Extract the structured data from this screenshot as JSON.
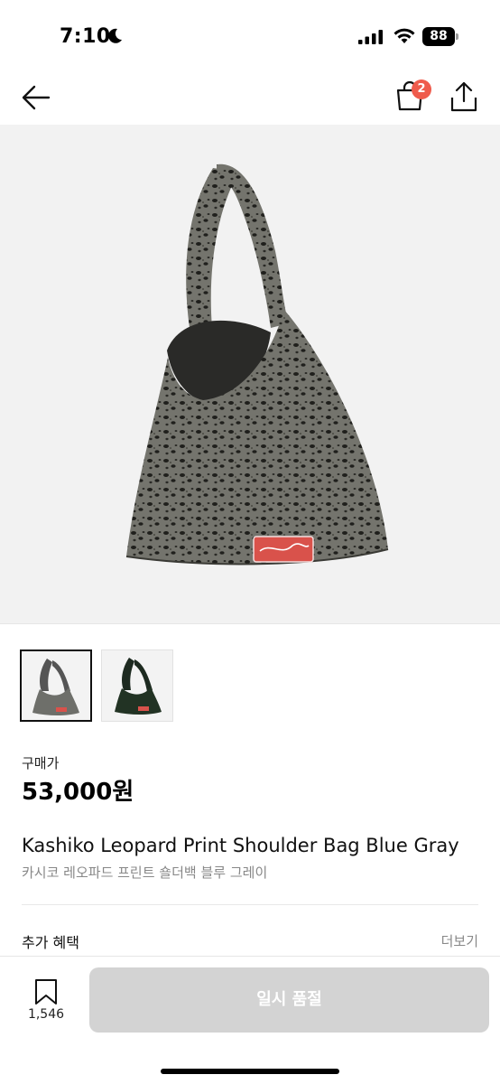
{
  "status_bar": {
    "time": "7:10",
    "battery": "88"
  },
  "header": {
    "back_icon": "arrow-left-icon",
    "cart_icon": "shopping-bag-icon",
    "cart_badge": "2",
    "share_icon": "share-icon"
  },
  "product": {
    "hero_icon": "leopard-shoulder-bag-image",
    "thumbnails": [
      {
        "icon": "bag-thumbnail-gray",
        "selected": true
      },
      {
        "icon": "bag-thumbnail-green",
        "selected": false
      }
    ],
    "price_label": "구매가",
    "price": "53,000원",
    "title": "Kashiko Leopard Print Shoulder Bag Blue Gray",
    "subtitle": "카시코 레오파드 프린트 숄더백 블루 그레이"
  },
  "benefits": {
    "label": "추가 혜택",
    "more": "더보기"
  },
  "bottom_bar": {
    "bookmark_icon": "bookmark-icon",
    "bookmark_count": "1,546",
    "soldout_label": "일시 품절"
  },
  "colors": {
    "badge": "#ef5b4c",
    "disabled_button": "#d3d3d3",
    "hero_bg": "#f2f2f2",
    "bag_body": "#6e6f6a",
    "bag_label": "#d9524b"
  }
}
